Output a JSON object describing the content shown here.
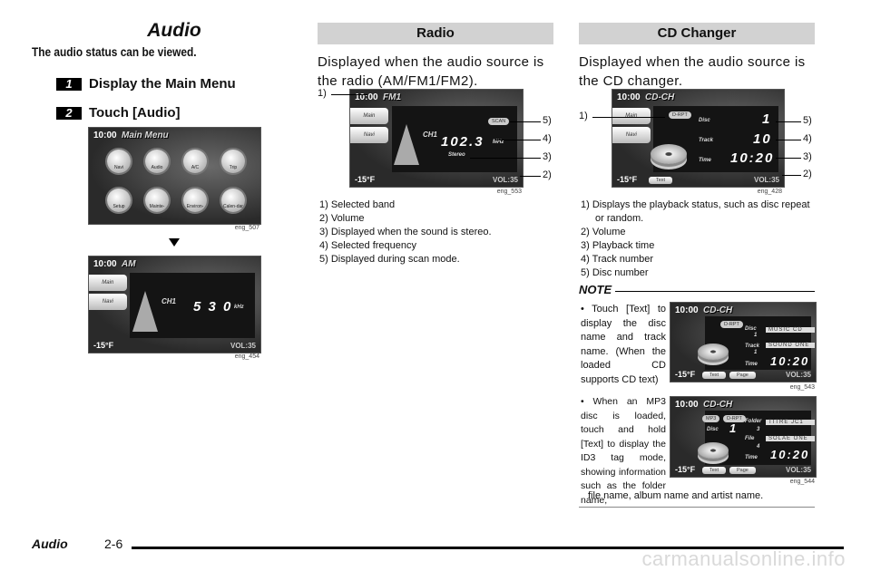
{
  "left": {
    "title": "Audio",
    "lead": "The audio status can be viewed.",
    "steps": [
      {
        "num": "1",
        "text": "Display the Main Menu"
      },
      {
        "num": "2",
        "text": "Touch [Audio]"
      }
    ],
    "main_menu_screen": {
      "clock": "10:00",
      "mode": "Main Menu",
      "buttons": [
        "Navi",
        "Audio",
        "A/C",
        "Trip",
        "Setup",
        "Mainte-nance",
        "Environ-ment",
        "Calen-dar"
      ],
      "caption": "eng_507"
    },
    "am_screen": {
      "clock": "10:00",
      "mode": "AM",
      "side": [
        "Main",
        "Navi"
      ],
      "channel": "CH1",
      "frequency": "5 3 0",
      "unit": "kHz",
      "temp": "-15°F",
      "vol": "VOL:35",
      "caption": "eng_454"
    }
  },
  "radio": {
    "header": "Radio",
    "intro": "Displayed when the audio source is the radio (AM/FM1/FM2).",
    "screen": {
      "clock": "10:00",
      "mode": "FM1",
      "side": [
        "Main",
        "Navi"
      ],
      "channel": "CH1",
      "frequency": "102.3",
      "unit": "MHz",
      "scan": "SCAN",
      "stereo": "Stereo",
      "temp": "-15°F",
      "vol": "VOL:35",
      "caption": "eng_553"
    },
    "callouts": [
      "1)",
      "5)",
      "4)",
      "3)",
      "2)"
    ],
    "list": [
      "1) Selected band",
      "2) Volume",
      "3) Displayed when the sound is stereo.",
      "4) Selected frequency",
      "5) Displayed during scan mode."
    ]
  },
  "cd": {
    "header": "CD Changer",
    "intro": "Displayed when the audio source is the CD changer.",
    "screen": {
      "clock": "10:00",
      "mode": "CD-CH",
      "side": [
        "Main",
        "Navi"
      ],
      "status": "D-RPT",
      "disc_label": "Disc",
      "disc": "1",
      "track_label": "Track",
      "track": "10",
      "time_label": "Time",
      "time": "10:20",
      "text_btn": "Text",
      "temp": "-15°F",
      "vol": "VOL:35",
      "caption": "eng_428"
    },
    "callouts": [
      "1)",
      "5)",
      "4)",
      "3)",
      "2)"
    ],
    "list": [
      "1) Displays the playback status, such as disc repeat or random.",
      "2) Volume",
      "3) Playback time",
      "4) Track number",
      "5) Disc number"
    ]
  },
  "note": {
    "heading": "NOTE",
    "bullet1": "• Touch [Text] to display the disc name and track name. (When the loaded CD supports CD text)",
    "screen1": {
      "clock": "10:00",
      "mode": "CD-CH",
      "status": "D-RPT",
      "disc_label": "Disc",
      "disc": "1",
      "track_label": "Track",
      "track": "1",
      "time_label": "Time",
      "field1": "MUSIC CD",
      "field2": "SOUND ONE",
      "time": "10:20",
      "text_btn": "Text",
      "page_btn": "Page",
      "temp": "-15°F",
      "vol": "VOL:35",
      "caption": "eng_543"
    },
    "bullet2": "• When an MP3 disc is loaded, touch and hold [Text] to display the ID3 tag mode, showing information such as the folder name,",
    "bullet2_tail": "file name, album name and artist name.",
    "screen2": {
      "clock": "10:00",
      "mode": "CD-CH",
      "mp3": "MP3",
      "status": "D-RPT",
      "disc_label": "Disc",
      "disc": "1",
      "folder_label": "Folder",
      "folder": "3",
      "file_label": "File",
      "file": "4",
      "time_label": "Time",
      "field1": "TITRE JC1",
      "field2": "SOLAE ONE",
      "time": "10:20",
      "text_btn": "Text",
      "page_btn": "Page",
      "temp": "-15°F",
      "vol": "VOL:35",
      "caption": "eng_544"
    }
  },
  "footer": {
    "section": "Audio",
    "page": "2-6",
    "watermark": "carmanualsonline.info"
  }
}
